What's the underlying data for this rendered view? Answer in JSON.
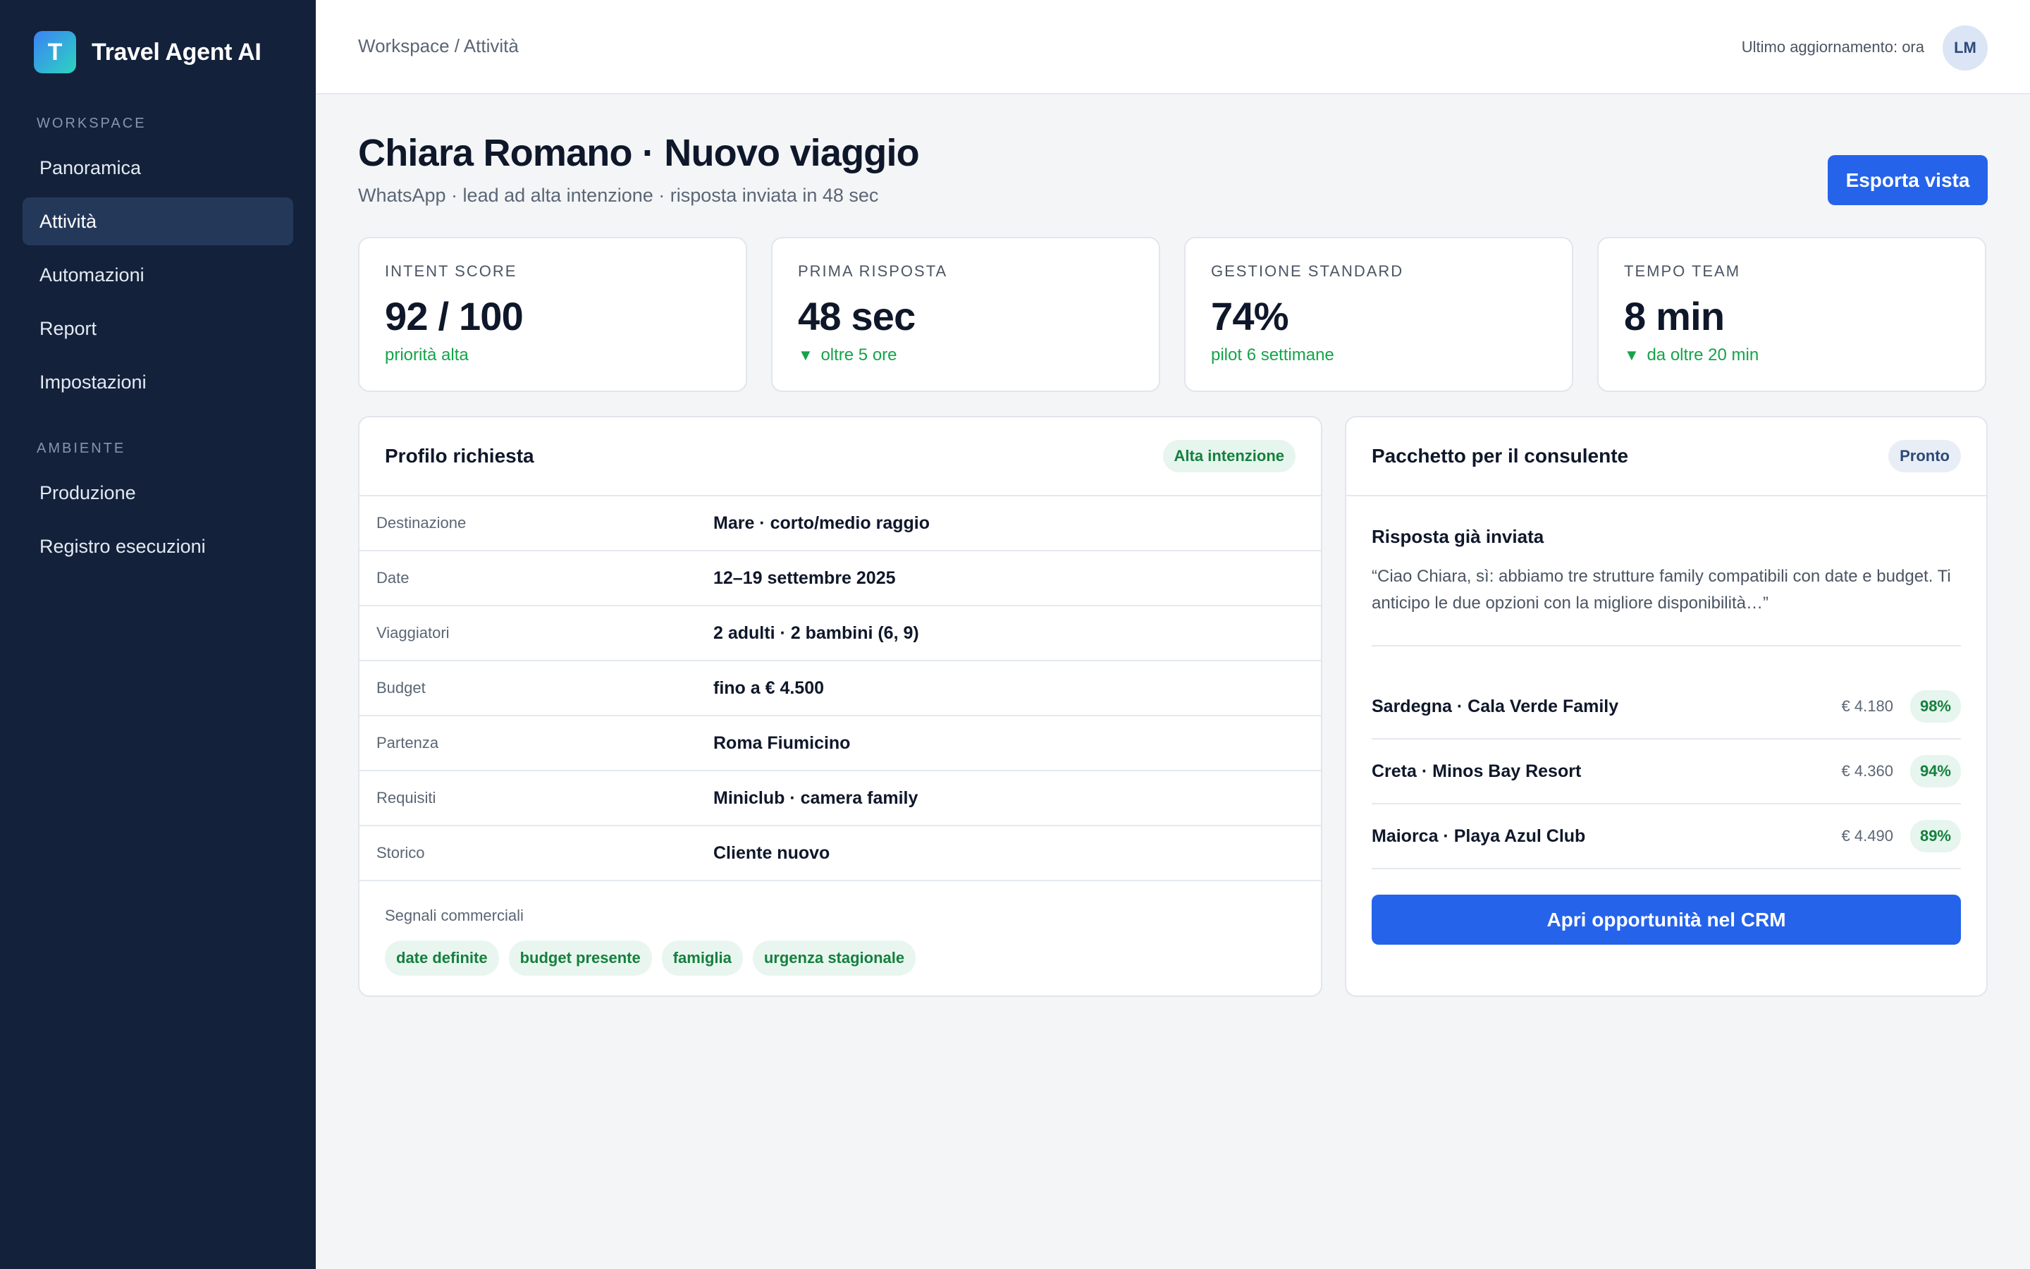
{
  "app": {
    "name": "Travel Agent AI",
    "logo_letter": "T"
  },
  "sidebar": {
    "sections": [
      {
        "label": "WORKSPACE",
        "items": [
          {
            "label": "Panoramica",
            "active": false
          },
          {
            "label": "Attività",
            "active": true
          },
          {
            "label": "Automazioni",
            "active": false
          },
          {
            "label": "Report",
            "active": false
          },
          {
            "label": "Impostazioni",
            "active": false
          }
        ]
      },
      {
        "label": "AMBIENTE",
        "items": [
          {
            "label": "Produzione",
            "active": false
          },
          {
            "label": "Registro esecuzioni",
            "active": false
          }
        ]
      }
    ]
  },
  "topbar": {
    "breadcrumb": "Workspace / Attività",
    "updated": "Ultimo aggiornamento: ora",
    "avatar_initials": "LM"
  },
  "header": {
    "title": "Chiara Romano · Nuovo viaggio",
    "subtitle": "WhatsApp · lead ad alta intenzione · risposta inviata in 48 sec",
    "export_label": "Esporta vista"
  },
  "stats": [
    {
      "label": "INTENT SCORE",
      "value": "92 / 100",
      "note": "priorità alta",
      "arrow": ""
    },
    {
      "label": "PRIMA RISPOSTA",
      "value": "48 sec",
      "note": "oltre 5 ore",
      "arrow": "▼"
    },
    {
      "label": "GESTIONE STANDARD",
      "value": "74%",
      "note": "pilot 6 settimane",
      "arrow": ""
    },
    {
      "label": "TEMPO TEAM",
      "value": "8 min",
      "note": "da oltre 20 min",
      "arrow": "▼"
    }
  ],
  "profile": {
    "title": "Profilo richiesta",
    "badge": "Alta intenzione",
    "rows": [
      {
        "label": "Destinazione",
        "value": "Mare · corto/medio raggio"
      },
      {
        "label": "Date",
        "value": "12–19 settembre 2025"
      },
      {
        "label": "Viaggiatori",
        "value": "2 adulti · 2 bambini (6, 9)"
      },
      {
        "label": "Budget",
        "value": "fino a € 4.500"
      },
      {
        "label": "Partenza",
        "value": "Roma Fiumicino"
      },
      {
        "label": "Requisiti",
        "value": "Miniclub · camera family"
      },
      {
        "label": "Storico",
        "value": "Cliente nuovo"
      }
    ],
    "signals_label": "Segnali commerciali",
    "signals": [
      "date definite",
      "budget presente",
      "famiglia",
      "urgenza stagionale"
    ]
  },
  "package": {
    "title": "Pacchetto per il consulente",
    "badge": "Pronto",
    "reply_title": "Risposta già inviata",
    "reply_text": "“Ciao Chiara, sì: abbiamo tre strutture family compatibili con date e budget. Ti anticipo le due opzioni con la migliore disponibilità…”",
    "options": [
      {
        "name": "Sardegna · Cala Verde Family",
        "price": "€ 4.180",
        "score": "98%"
      },
      {
        "name": "Creta · Minos Bay Resort",
        "price": "€ 4.360",
        "score": "94%"
      },
      {
        "name": "Maiorca · Playa Azul Club",
        "price": "€ 4.490",
        "score": "89%"
      }
    ],
    "cta_label": "Apri opportunità nel CRM"
  },
  "colors": {
    "sidebar_bg": "#13213a",
    "accent": "#2563eb",
    "success": "#16a34a"
  }
}
